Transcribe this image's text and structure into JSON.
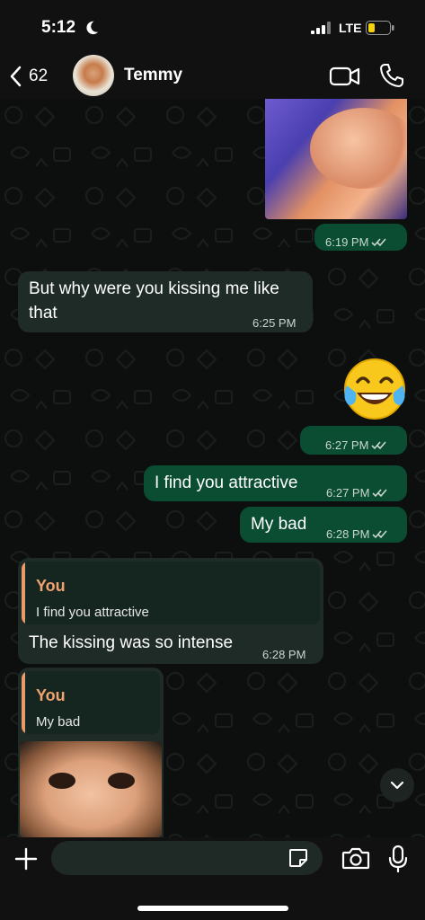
{
  "status_bar": {
    "time": "5:12",
    "network": "LTE"
  },
  "header": {
    "back_count": "62",
    "contact_name": "Temmy"
  },
  "messages": [
    {
      "id": "photo-sent",
      "direction": "outgoing",
      "type": "image",
      "time": "6:19 PM"
    },
    {
      "id": "msg-1",
      "direction": "incoming",
      "text_line1": "But why were you kissing me like",
      "text_line2": "that",
      "time": "6:25 PM"
    },
    {
      "id": "emoji-sent",
      "direction": "outgoing",
      "type": "emoji",
      "emoji": "face-with-tears-of-joy",
      "time": "6:27 PM"
    },
    {
      "id": "msg-2",
      "direction": "outgoing",
      "text": "I find you attractive",
      "time": "6:27 PM"
    },
    {
      "id": "msg-3",
      "direction": "outgoing",
      "text": "My bad",
      "time": "6:28 PM"
    },
    {
      "id": "msg-4",
      "direction": "incoming",
      "reply_author": "You",
      "reply_text": "I find you attractive",
      "text": "The kissing was so intense",
      "time": "6:28 PM"
    },
    {
      "id": "msg-5",
      "direction": "incoming",
      "reply_author": "You",
      "reply_text": "My bad",
      "type": "image"
    }
  ],
  "composer": {
    "placeholder": ""
  },
  "colors": {
    "outgoing_bubble": "#0a4d33",
    "incoming_bubble": "#1f2b27",
    "reply_accent": "#f0a26f",
    "background": "#0d0f0e"
  }
}
